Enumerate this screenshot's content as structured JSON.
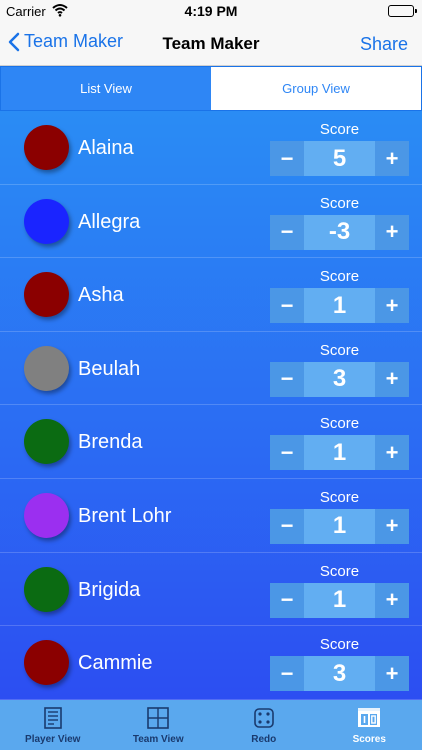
{
  "status_bar": {
    "carrier": "Carrier",
    "time": "4:19 PM"
  },
  "nav": {
    "back_label": "Team Maker",
    "title": "Team Maker",
    "share_label": "Share"
  },
  "segments": [
    {
      "label": "List View",
      "active": true
    },
    {
      "label": "Group View",
      "active": false
    }
  ],
  "score_label": "Score",
  "stepper": {
    "minus": "−",
    "plus": "+"
  },
  "players": [
    {
      "name": "Alaina",
      "score": "5",
      "color": "#8b0000"
    },
    {
      "name": "Allegra",
      "score": "-3",
      "color": "#1a24ff"
    },
    {
      "name": "Asha",
      "score": "1",
      "color": "#8b0000"
    },
    {
      "name": "Beulah",
      "score": "3",
      "color": "#808080"
    },
    {
      "name": "Brenda",
      "score": "1",
      "color": "#0b6b12"
    },
    {
      "name": "Brent Lohr",
      "score": "1",
      "color": "#9b2ff0"
    },
    {
      "name": "Brigida",
      "score": "1",
      "color": "#0b6b12"
    },
    {
      "name": "Cammie",
      "score": "3",
      "color": "#8b0000"
    }
  ],
  "tabs": [
    {
      "label": "Player View",
      "icon": "player-view-icon"
    },
    {
      "label": "Team View",
      "icon": "team-view-icon"
    },
    {
      "label": "Redo",
      "icon": "dice-icon"
    },
    {
      "label": "Scores",
      "icon": "scoreboard-icon"
    }
  ]
}
